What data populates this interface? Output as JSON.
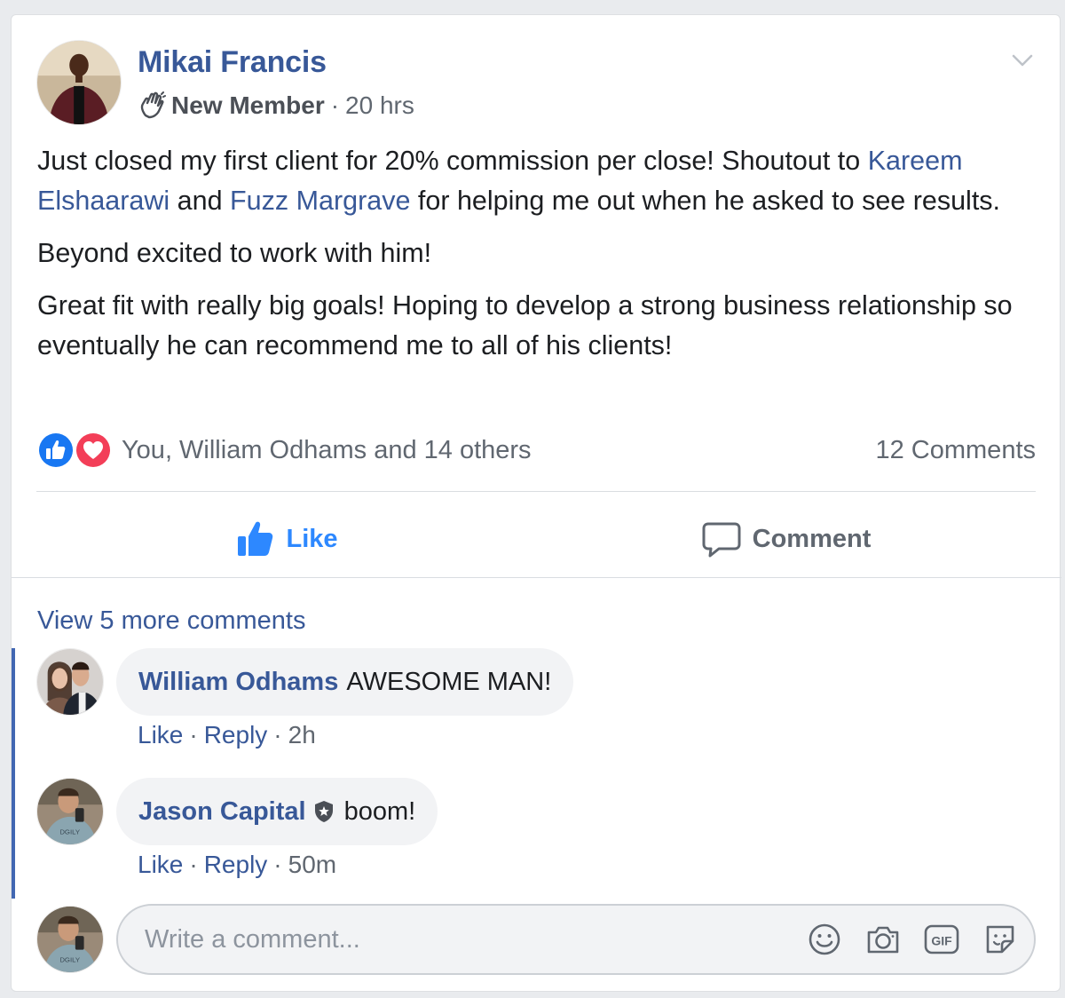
{
  "post": {
    "author": "Mikai Francis",
    "badge": "New Member",
    "time": "20 hrs",
    "body": {
      "p1_before": "Just closed my first client for 20% commission per close! Shoutout to ",
      "mention1": "Kareem Elshaarawi",
      "p1_and": " and ",
      "mention2": "Fuzz Margrave",
      "p1_after": " for helping me out when he asked to see results.",
      "p2": "Beyond excited to work with him!",
      "p3": "Great fit with really big goals! Hoping to develop a strong business relationship so eventually he can recommend me to all of his clients!"
    },
    "reactions_text": "You, William Odhams and 14 others",
    "comments_count": "12 Comments"
  },
  "actions": {
    "like": "Like",
    "comment": "Comment"
  },
  "view_more": "View 5 more comments",
  "comments": [
    {
      "author": "William Odhams",
      "text": "AWESOME MAN!",
      "like": "Like",
      "reply": "Reply",
      "time": "2h"
    },
    {
      "author": "Jason Capital",
      "text": "boom!",
      "like": "Like",
      "reply": "Reply",
      "time": "50m"
    }
  ],
  "composer": {
    "placeholder": "Write a comment..."
  },
  "icons": {
    "header": [
      "wave-icon",
      "chevron-down-icon"
    ],
    "reactions": [
      "like-reaction-icon",
      "love-reaction-icon"
    ],
    "composer": [
      "emoji-icon",
      "camera-icon",
      "gif-icon",
      "sticker-icon"
    ]
  },
  "colors": {
    "link": "#385898",
    "like_blue": "#2d88ff",
    "love_red": "#f33e58",
    "thread_bar": "#4267b2",
    "bubble": "#f2f3f5"
  }
}
